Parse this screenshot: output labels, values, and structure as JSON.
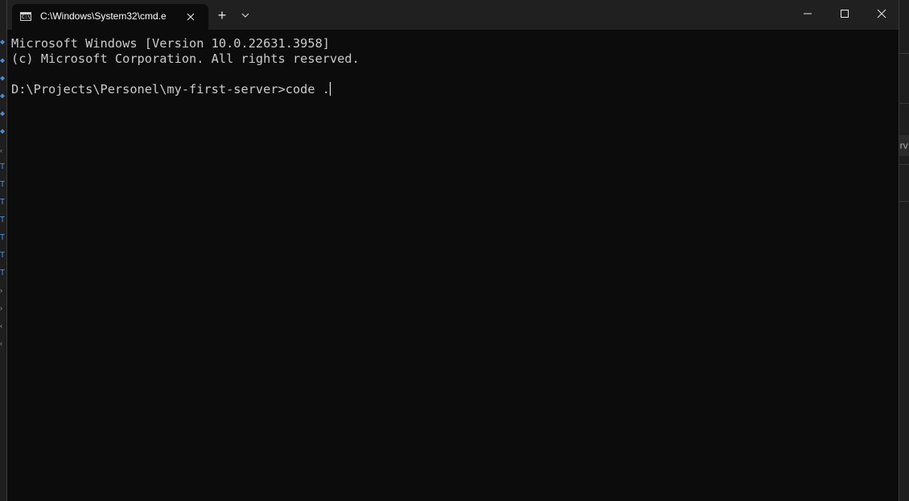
{
  "window": {
    "tab_title": "C:\\Windows\\System32\\cmd.e",
    "tab_icon": "cmd-console-icon",
    "new_tab_label": "+",
    "minimize_icon": "minimize-icon",
    "maximize_icon": "maximize-icon",
    "close_icon": "close-icon"
  },
  "console": {
    "lines": [
      "Microsoft Windows [Version 10.0.22631.3958]",
      "(c) Microsoft Corporation. All rights reserved.",
      "",
      "D:\\Projects\\Personel\\my-first-server>code ."
    ]
  },
  "background": {
    "right_peek_text": "erv"
  },
  "colors": {
    "console_bg": "#0c0c0c",
    "titlebar_bg": "#202020",
    "text": "#cccccc"
  }
}
